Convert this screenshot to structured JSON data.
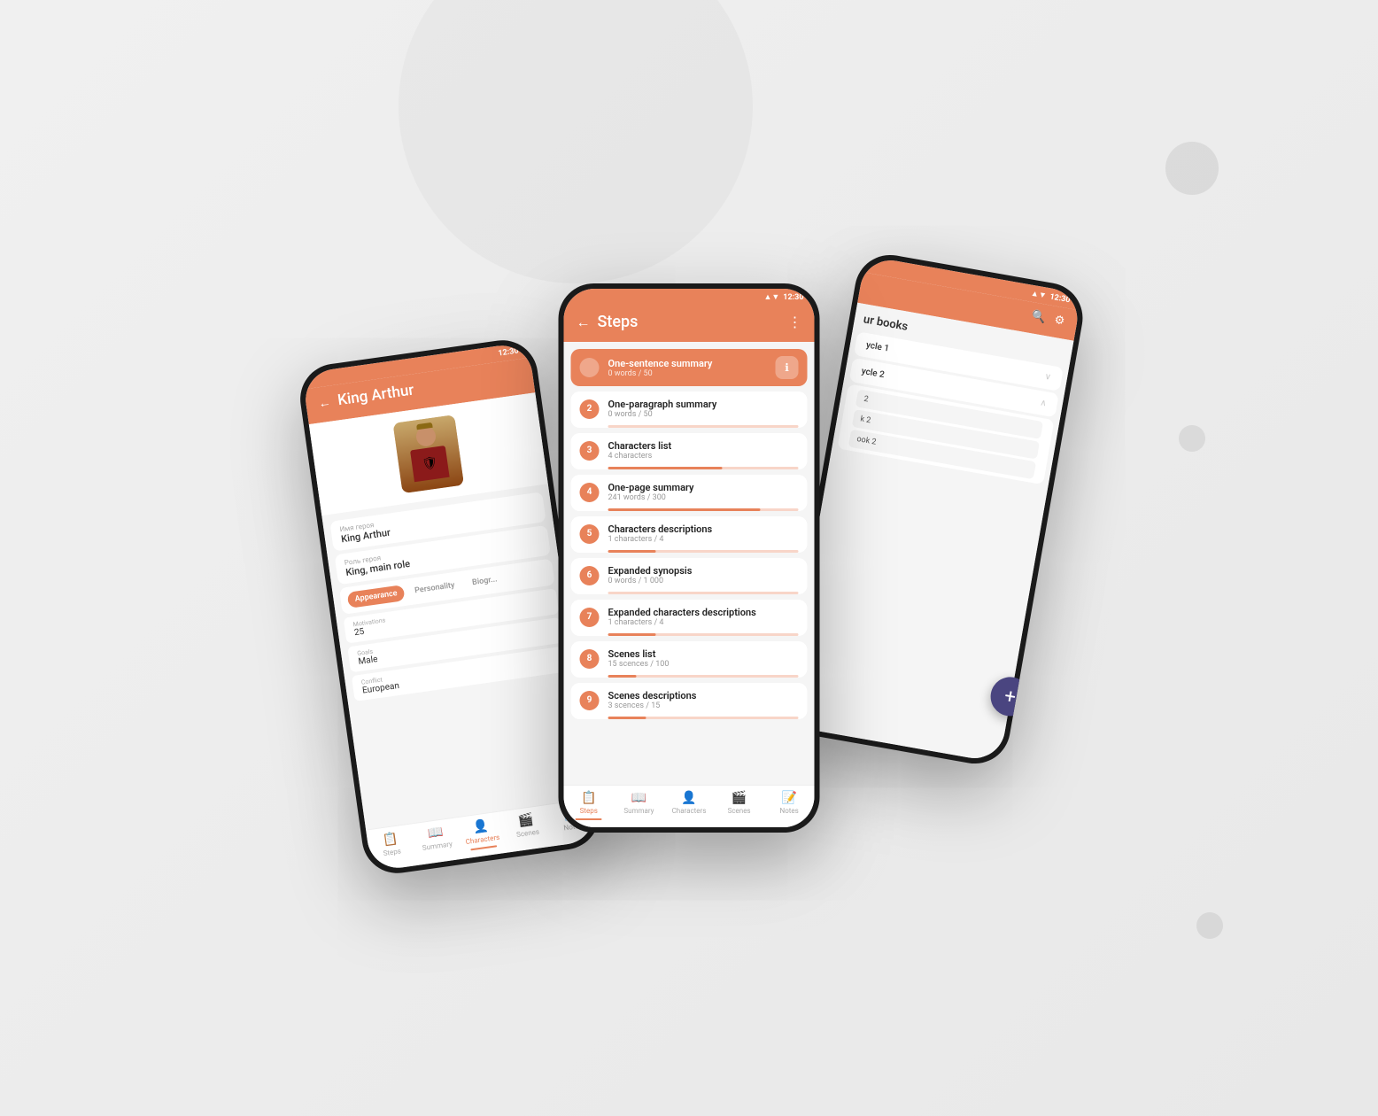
{
  "background": {
    "color": "#ebebeb"
  },
  "center_phone": {
    "status_bar": {
      "time": "12:30",
      "signal_icon": "▲▲",
      "wifi_icon": "▼",
      "battery_icon": "▮"
    },
    "app_bar": {
      "back_icon": "←",
      "title": "Steps",
      "menu_icon": "⋮"
    },
    "steps": [
      {
        "number": "",
        "title": "One-sentence summary",
        "subtitle": "0 words / 50",
        "progress": 0,
        "has_info": true
      },
      {
        "number": "2",
        "title": "One-paragraph summary",
        "subtitle": "0 words / 50",
        "progress": 0,
        "has_info": false
      },
      {
        "number": "3",
        "title": "Characters list",
        "subtitle": "4 characters",
        "progress": 60,
        "has_info": false
      },
      {
        "number": "4",
        "title": "One-page summary",
        "subtitle": "241 words / 300",
        "progress": 80,
        "has_info": false
      },
      {
        "number": "5",
        "title": "Characters descriptions",
        "subtitle": "1 characters / 4",
        "progress": 25,
        "has_info": false
      },
      {
        "number": "6",
        "title": "Expanded synopsis",
        "subtitle": "0 words / 1 000",
        "progress": 0,
        "has_info": false
      },
      {
        "number": "7",
        "title": "Expanded characters descriptions",
        "subtitle": "1 characters / 4",
        "progress": 25,
        "has_info": false
      },
      {
        "number": "8",
        "title": "Scenes list",
        "subtitle": "15 scences / 100",
        "progress": 15,
        "has_info": false
      },
      {
        "number": "9",
        "title": "Scenes descriptions",
        "subtitle": "3 scences / 15",
        "progress": 20,
        "has_info": false
      }
    ],
    "bottom_nav": [
      {
        "icon": "📋",
        "label": "Steps",
        "active": true
      },
      {
        "icon": "📖",
        "label": "Summary",
        "active": false
      },
      {
        "icon": "👤",
        "label": "Characters",
        "active": false
      },
      {
        "icon": "🎬",
        "label": "Scenes",
        "active": false
      },
      {
        "icon": "📝",
        "label": "Notes",
        "active": false
      }
    ]
  },
  "left_phone": {
    "status_bar": {
      "time": "12:30"
    },
    "app_bar": {
      "back_icon": "←",
      "title": "King Arthur"
    },
    "character": {
      "name_label": "Имя героя",
      "name_value": "King Arthur",
      "role_label": "Роль героя",
      "role_value": "King, main role",
      "tabs": [
        "Appearance",
        "Personality",
        "Biogr..."
      ],
      "active_tab": 0,
      "fields": [
        {
          "label": "Motivations",
          "value": "25"
        },
        {
          "label": "Goals",
          "value": "Male"
        },
        {
          "label": "Conflict",
          "value": "European"
        }
      ]
    },
    "bottom_nav": [
      {
        "icon": "📋",
        "label": "Steps",
        "active": false
      },
      {
        "icon": "📖",
        "label": "Summary",
        "active": false
      },
      {
        "icon": "👤",
        "label": "Characters",
        "active": true
      },
      {
        "icon": "🎬",
        "label": "Scenes",
        "active": false
      },
      {
        "icon": "📝",
        "label": "Notes",
        "active": false
      }
    ]
  },
  "right_phone": {
    "status_bar": {
      "time": "12:30"
    },
    "app_bar": {
      "search_icon": "🔍",
      "settings_icon": "⚙"
    },
    "books_title": "ur books",
    "list_items": [
      {
        "title": "ycle 1",
        "chevron": "∨"
      },
      {
        "title": "ycle 2",
        "chevron": "∧"
      },
      {
        "title": "2",
        "chevron": ""
      },
      {
        "title": "k 2",
        "chevron": ""
      },
      {
        "title": "ook 2",
        "chevron": ""
      }
    ],
    "fab": {
      "icon": "+"
    }
  }
}
